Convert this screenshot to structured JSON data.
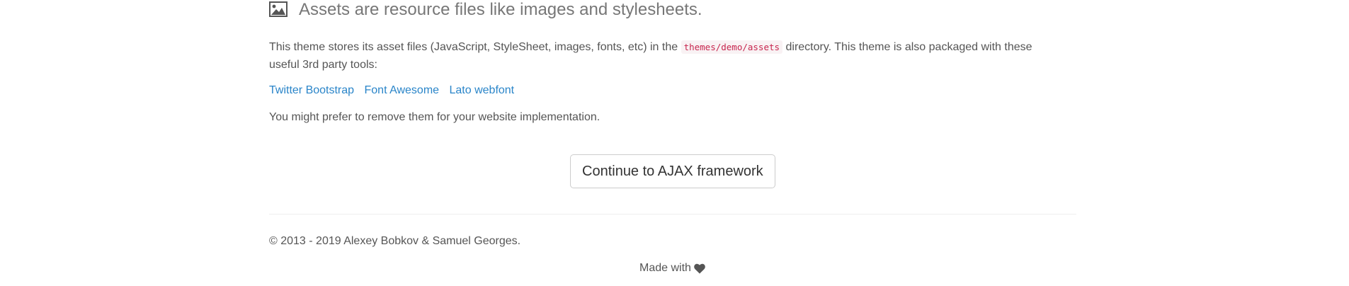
{
  "assets": {
    "heading": "Assets are resource files like images and stylesheets.",
    "icon": "picture-icon",
    "description_before": "This theme stores its asset files (JavaScript, StyleSheet, images, fonts, etc) in the ",
    "path_code": "themes/demo/assets",
    "description_after": " directory. This theme is also packaged with these useful 3rd party tools:",
    "links": [
      {
        "label": "Twitter Bootstrap"
      },
      {
        "label": "Font Awesome"
      },
      {
        "label": "Lato webfont"
      }
    ],
    "note": "You might prefer to remove them for your website implementation."
  },
  "continue_button": {
    "label": "Continue to AJAX framework"
  },
  "footer": {
    "copyright": "© 2013 - 2019 Alexey Bobkov & Samuel Georges.",
    "made_with": "Made with",
    "heart_icon": "heart-icon"
  },
  "colors": {
    "link": "#2a85c9",
    "text": "#555555",
    "heading": "#777777",
    "code_text": "#c7254e",
    "code_bg": "#f9f2f4"
  }
}
